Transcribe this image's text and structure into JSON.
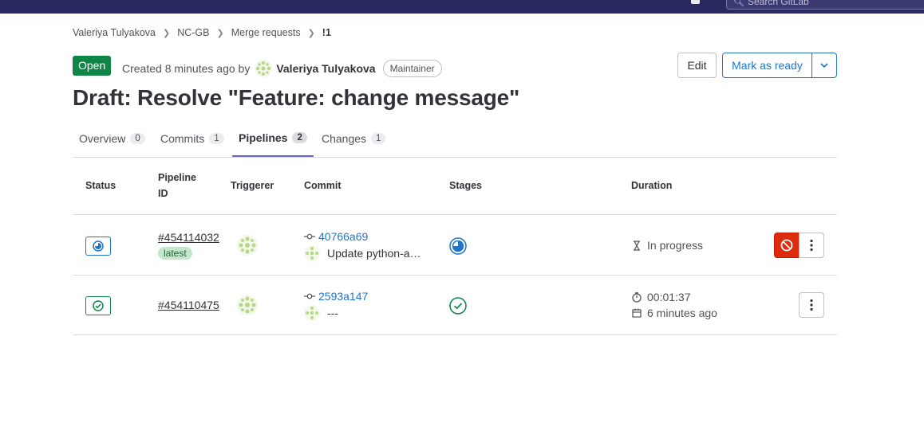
{
  "topbar": {
    "search_placeholder": "Search GitLab"
  },
  "breadcrumb": [
    "Valeriya Tulyakova",
    "NC-GB",
    "Merge requests",
    "!1"
  ],
  "mr": {
    "state": "Open",
    "created_prefix": "Created 8 minutes ago by",
    "author": "Valeriya Tulyakova",
    "role": "Maintainer",
    "title": "Draft: Resolve \"Feature: change message\""
  },
  "actions": {
    "edit": "Edit",
    "mark_ready": "Mark as ready"
  },
  "tabs": [
    {
      "label": "Overview",
      "count": "0"
    },
    {
      "label": "Commits",
      "count": "1"
    },
    {
      "label": "Pipelines",
      "count": "2",
      "active": true
    },
    {
      "label": "Changes",
      "count": "1"
    }
  ],
  "table": {
    "headers": {
      "status": "Status",
      "pipeline_id_1": "Pipeline",
      "pipeline_id_2": "ID",
      "triggerer": "Triggerer",
      "commit": "Commit",
      "stages": "Stages",
      "duration": "Duration"
    },
    "rows": [
      {
        "status": "running",
        "pipeline_id": "#454114032",
        "badge": "latest",
        "sha": "40766a69",
        "message": "Update python-a…",
        "duration": "In progress",
        "status_color": "#1f75cb"
      },
      {
        "status": "passed",
        "pipeline_id": "#454110475",
        "sha": "2593a147",
        "message": "---",
        "duration": "00:01:37",
        "finished": "6 minutes ago",
        "status_color": "#108548"
      }
    ]
  },
  "colors": {
    "brand_nav": "#292961",
    "open_green": "#108548",
    "link_blue": "#1f75cb",
    "danger_red": "#dd2b0e",
    "tab_indicator": "#6666c4"
  },
  "icons": [
    "search-icon",
    "chevron-down-icon",
    "commit-icon",
    "hourglass-icon",
    "timer-icon",
    "calendar-icon",
    "cancel-icon",
    "kebab-icon",
    "status-running-icon",
    "status-passed-icon"
  ]
}
